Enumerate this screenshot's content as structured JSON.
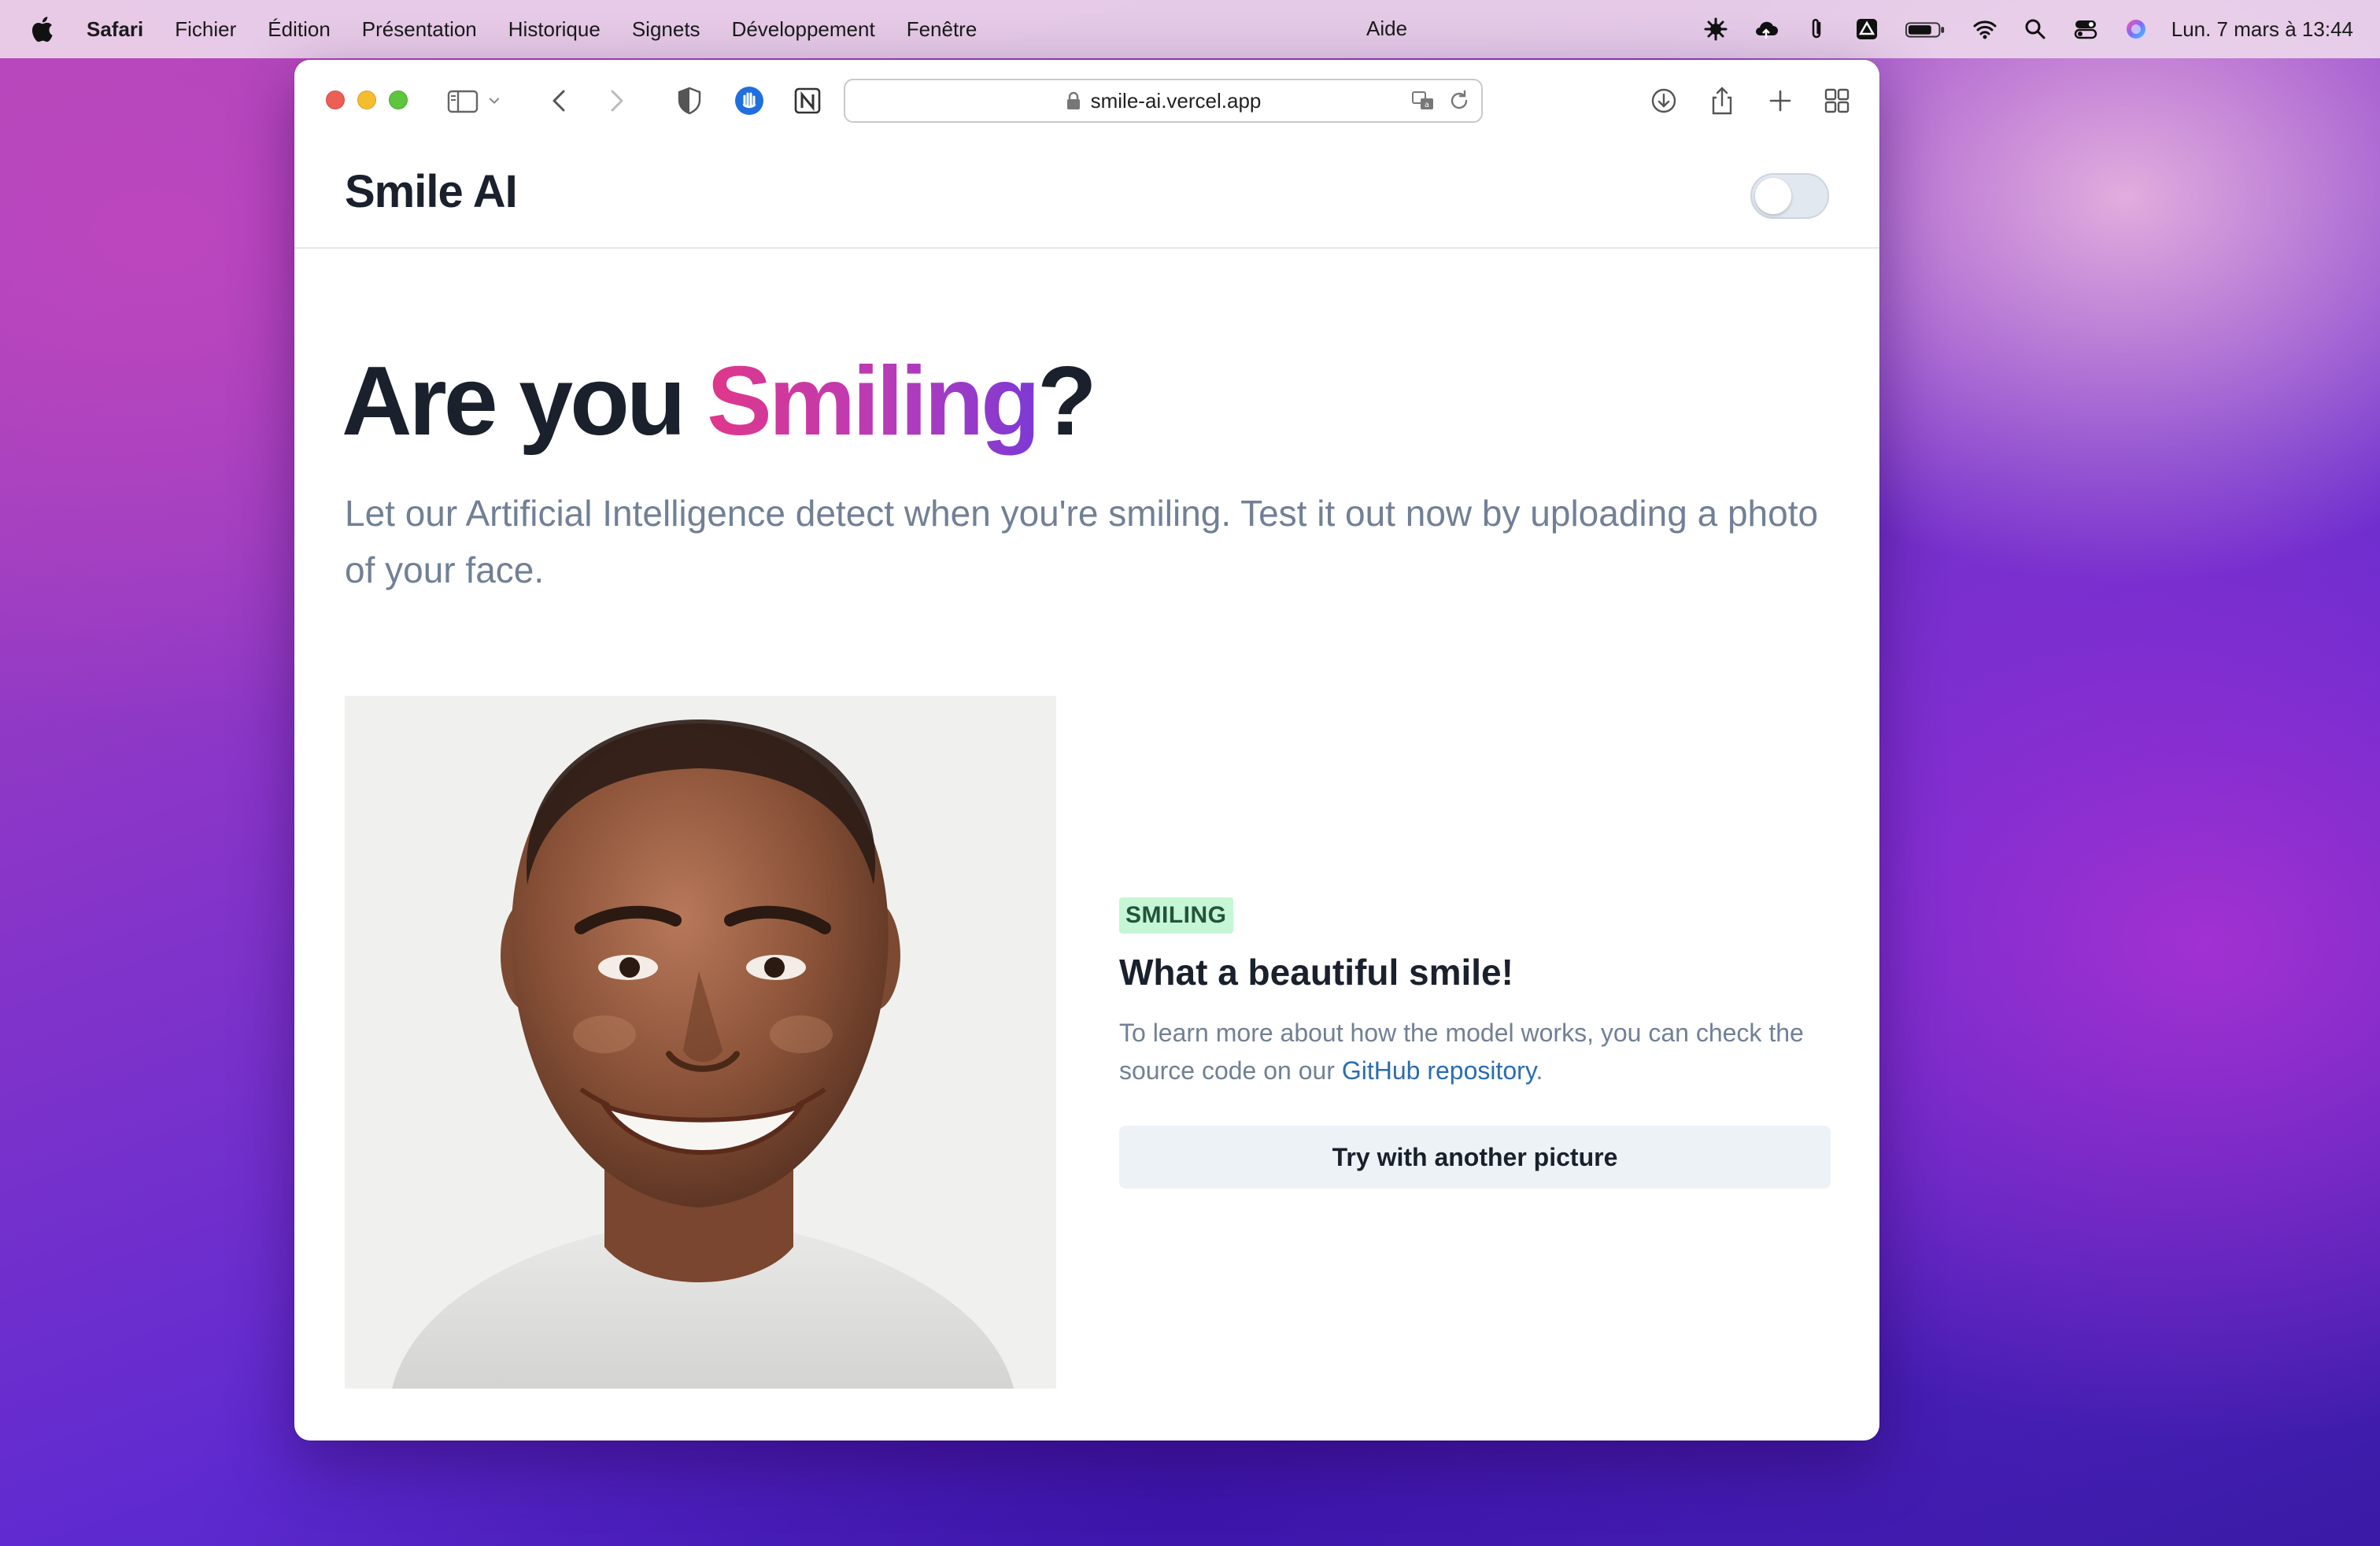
{
  "menubar": {
    "app": "Safari",
    "items": [
      "Fichier",
      "Édition",
      "Présentation",
      "Historique",
      "Signets",
      "Développement",
      "Fenêtre"
    ],
    "help": "Aide",
    "clock": "Lun. 7 mars à  13:44"
  },
  "browser": {
    "url": "smile-ai.vercel.app"
  },
  "site": {
    "logo": "Smile AI",
    "dark_mode_toggle": "off",
    "hero": {
      "title_prefix": "Are you ",
      "title_highlight": "Smiling",
      "title_suffix": "?",
      "subtitle": "Let our Artificial Intelligence detect when you're smiling. Test it out now by uploading a photo of your face."
    },
    "result": {
      "badge": "SMILING",
      "heading": "What a beautiful smile!",
      "text_before_link": "To learn more about how the model works, you can check the source code on our ",
      "link": "GitHub repository",
      "text_after_link": ".",
      "button": "Try with another picture"
    }
  },
  "colors": {
    "gradient_start": "#e0378a",
    "gradient_end": "#7c3ad6",
    "badge_bg": "#c6f6d5",
    "badge_text": "#22543d",
    "link": "#2b6cb0"
  }
}
